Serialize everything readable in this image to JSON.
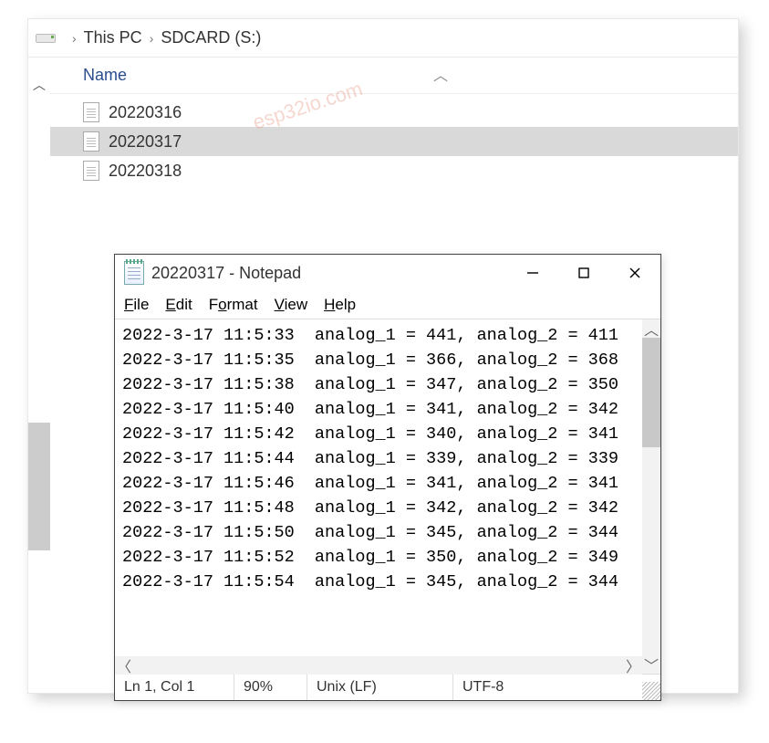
{
  "breadcrumb": {
    "item1": "This PC",
    "item2": "SDCARD (S:)"
  },
  "watermark": "esp32io.com",
  "columns": {
    "name": "Name"
  },
  "files": [
    {
      "name": "20220316",
      "selected": false
    },
    {
      "name": "20220317",
      "selected": true
    },
    {
      "name": "20220318",
      "selected": false
    }
  ],
  "notepad": {
    "title": "20220317 - Notepad",
    "menu": {
      "file": {
        "u": "F",
        "rest": "ile"
      },
      "edit": {
        "u": "E",
        "rest": "dit"
      },
      "format": {
        "pre": "F",
        "u": "o",
        "rest": "rmat"
      },
      "view": {
        "u": "V",
        "rest": "iew"
      },
      "help": {
        "u": "H",
        "rest": "elp"
      }
    },
    "lines": [
      "2022-3-17 11:5:33  analog_1 = 441, analog_2 = 411",
      "2022-3-17 11:5:35  analog_1 = 366, analog_2 = 368",
      "2022-3-17 11:5:38  analog_1 = 347, analog_2 = 350",
      "2022-3-17 11:5:40  analog_1 = 341, analog_2 = 342",
      "2022-3-17 11:5:42  analog_1 = 340, analog_2 = 341",
      "2022-3-17 11:5:44  analog_1 = 339, analog_2 = 339",
      "2022-3-17 11:5:46  analog_1 = 341, analog_2 = 341",
      "2022-3-17 11:5:48  analog_1 = 342, analog_2 = 342",
      "2022-3-17 11:5:50  analog_1 = 345, analog_2 = 344",
      "2022-3-17 11:5:52  analog_1 = 350, analog_2 = 349",
      "2022-3-17 11:5:54  analog_1 = 345, analog_2 = 344"
    ],
    "status": {
      "pos": "Ln 1, Col 1",
      "zoom": "90%",
      "lineend": "Unix (LF)",
      "encoding": "UTF-8"
    }
  }
}
